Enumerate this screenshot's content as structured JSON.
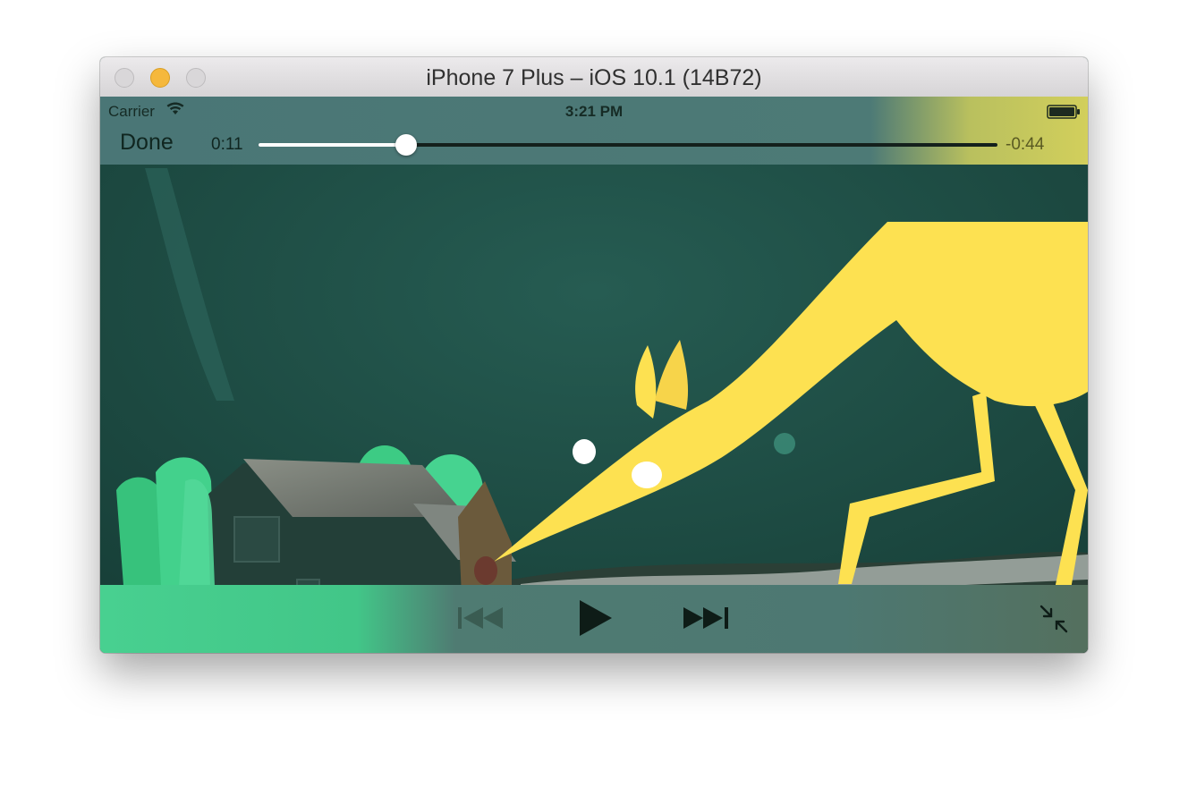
{
  "window": {
    "title": "iPhone 7 Plus – iOS 10.1 (14B72)"
  },
  "status_bar": {
    "carrier": "Carrier",
    "time": "3:21 PM",
    "wifi_icon": "wifi-icon",
    "battery_icon": "battery-icon"
  },
  "player": {
    "done_label": "Done",
    "current_time": "0:11",
    "remaining_time": "-0:44",
    "progress": 0.2,
    "controls": {
      "previous_icon": "skip-back-icon",
      "play_icon": "play-icon",
      "next_icon": "skip-forward-icon",
      "exit_fullscreen_icon": "exit-fullscreen-icon"
    }
  },
  "colors": {
    "accent_yellow": "#FDE151",
    "scene_green": "#1F4D45",
    "plant_green": "#3DCB84"
  }
}
